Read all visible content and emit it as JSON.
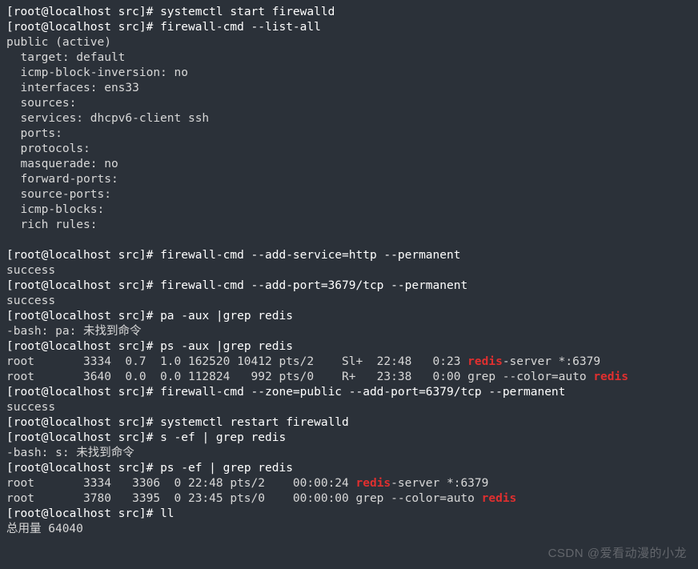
{
  "prompt": "[root@localhost src]# ",
  "cmds": {
    "c1": "systemctl start firewalld",
    "c2": "firewall-cmd --list-all",
    "c3": "firewall-cmd --add-service=http --permanent",
    "c4": "firewall-cmd --add-port=3679/tcp --permanent",
    "c5": "pa -aux |grep redis",
    "c6": "ps -aux |grep redis",
    "c7": "firewall-cmd --zone=public --add-port=6379/tcp --permanent",
    "c8": "systemctl restart firewalld",
    "c9": "s -ef | grep redis",
    "c10": "ps -ef | grep redis",
    "c11": "ll"
  },
  "listall": {
    "l0": "public (active)",
    "l1": "  target: default",
    "l2": "  icmp-block-inversion: no",
    "l3": "  interfaces: ens33",
    "l4": "  sources:",
    "l5": "  services: dhcpv6-client ssh",
    "l6": "  ports:",
    "l7": "  protocols:",
    "l8": "  masquerade: no",
    "l9": "  forward-ports:",
    "l10": "  source-ports:",
    "l11": "  icmp-blocks:",
    "l12": "  rich rules:"
  },
  "success": "success",
  "err_pa": "-bash: pa: 未找到命令",
  "err_s": "-bash: s: 未找到命令",
  "psaux": {
    "r1a": "root       3334  0.7  1.0 162520 10412 pts/2    Sl+  22:48   0:23 ",
    "r1m": "redis",
    "r1b": "-server *:6379",
    "r2a": "root       3640  0.0  0.0 112824   992 pts/0    R+   23:38   0:00 grep --color=auto ",
    "r2m": "redis"
  },
  "psef": {
    "r1a": "root       3334   3306  0 22:48 pts/2    00:00:24 ",
    "r1m": "redis",
    "r1b": "-server *:6379",
    "r2a": "root       3780   3395  0 23:45 pts/0    00:00:00 grep --color=auto ",
    "r2m": "redis"
  },
  "ll_total": "总用量 64040",
  "watermark": "CSDN @爱看动漫的小龙"
}
